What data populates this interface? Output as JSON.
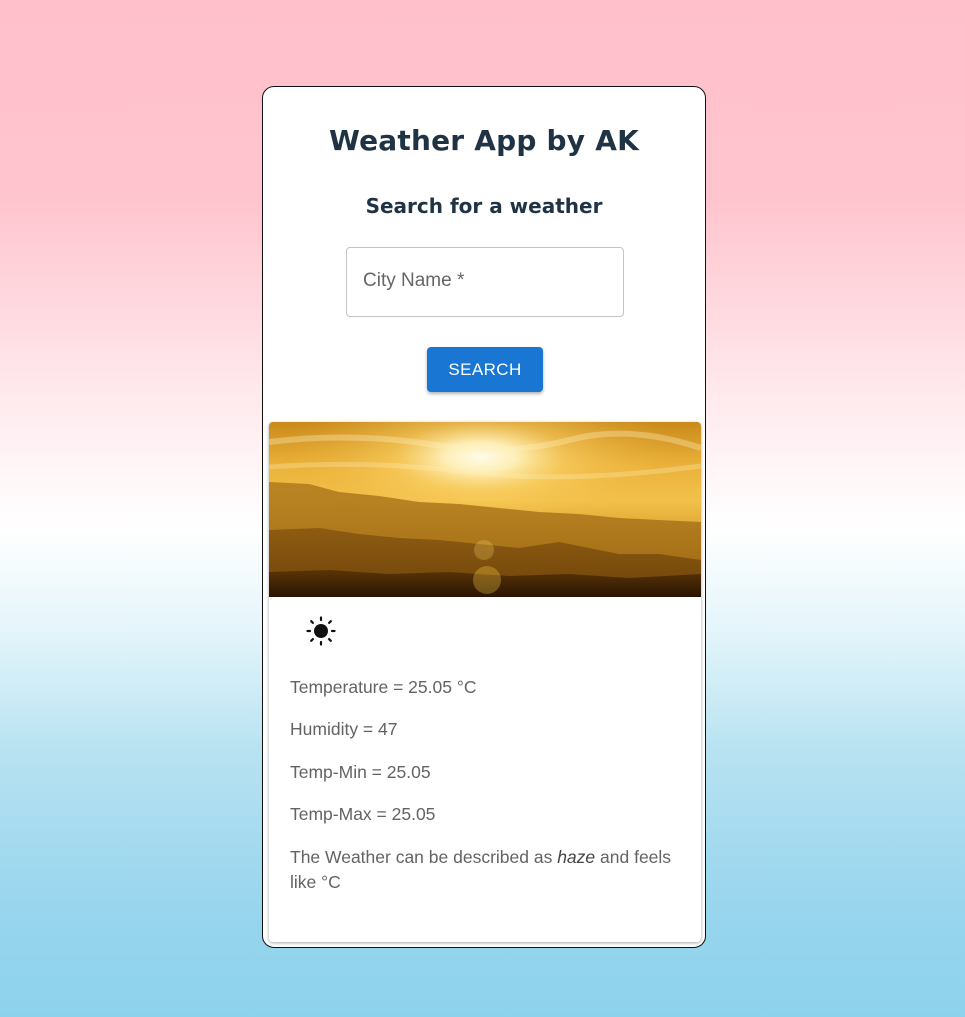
{
  "app": {
    "title": "Weather App by AK",
    "subtitle": "Search for a weather"
  },
  "search": {
    "placeholder": "City Name *",
    "value": "",
    "button_label": "SEARCH",
    "button_color": "#1976d2"
  },
  "result": {
    "icon": "sun-icon",
    "temperature": "Temperature = 25.05 °C",
    "humidity": "Humidity = 47",
    "temp_min": "Temp-Min = 25.05",
    "temp_max": "Temp-Max = 25.05",
    "description_prefix": "The Weather can be described as ",
    "description_value": "haze",
    "description_suffix": " and feels like °C"
  }
}
